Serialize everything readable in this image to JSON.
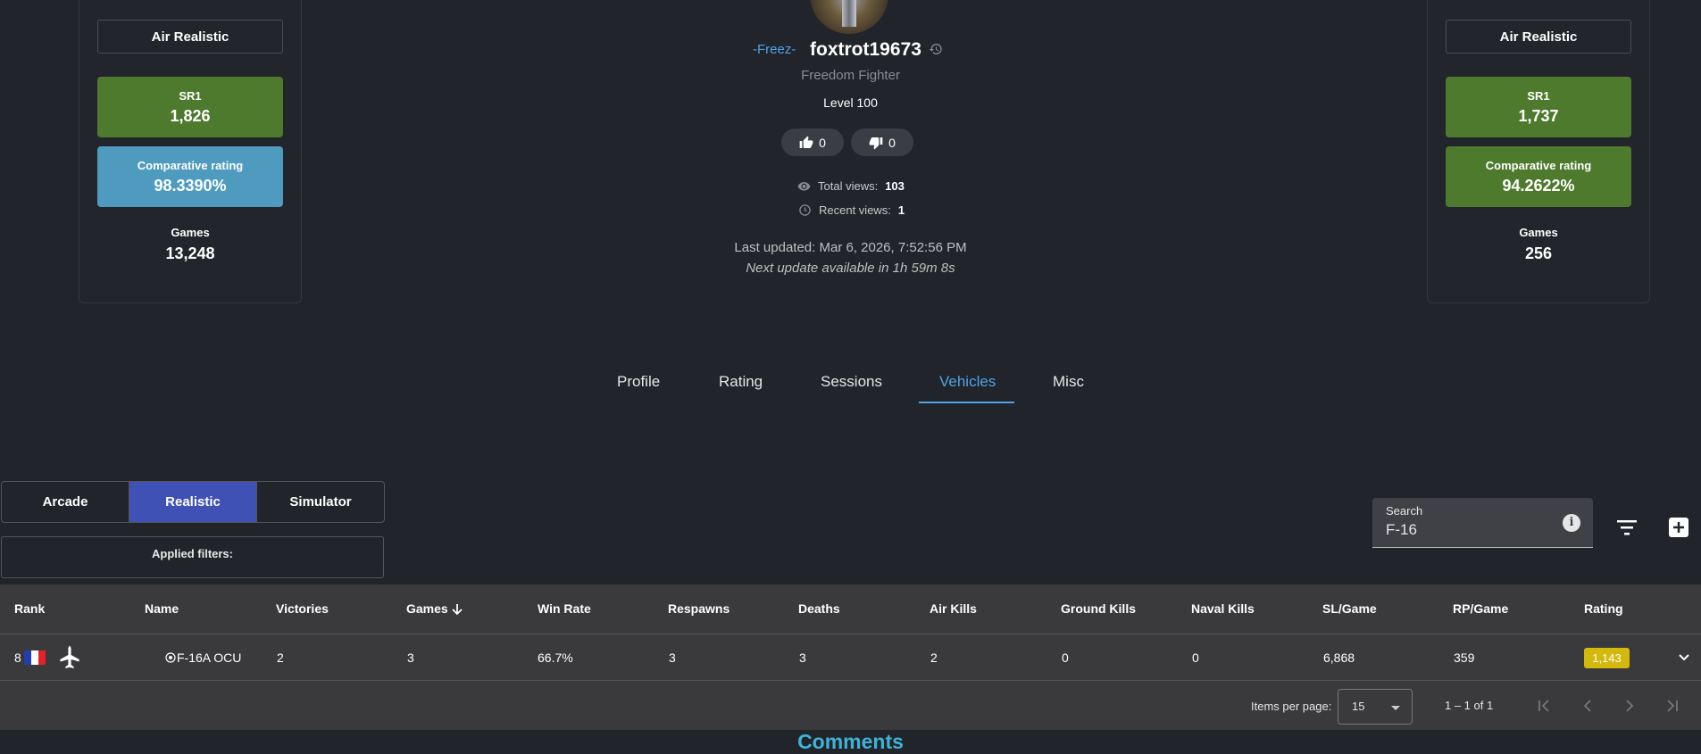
{
  "left_card": {
    "mode": "Air Realistic",
    "sr_label": "SR1",
    "sr_value": "1,826",
    "comp_label": "Comparative rating",
    "comp_value": "98.3390%",
    "games_label": "Games",
    "games_value": "13,248",
    "comp_color": "#4f9bc0"
  },
  "right_card": {
    "mode": "Air Realistic",
    "sr_label": "SR1",
    "sr_value": "1,737",
    "comp_label": "Comparative rating",
    "comp_value": "94.2622%",
    "games_label": "Games",
    "games_value": "256",
    "comp_color": "#4e7a2e"
  },
  "profile": {
    "clan": "-Freez-",
    "nickname": "foxtrot19673",
    "title": "Freedom Fighter",
    "level": "Level 100",
    "likes": "0",
    "dislikes": "0",
    "total_views_label": "Total views:",
    "total_views": "103",
    "recent_views_label": "Recent views:",
    "recent_views": "1",
    "last_updated": "Last updated: Mar 6, 2026, 7:52:56 PM",
    "next_update": "Next update available in 1h 59m 8s"
  },
  "tabs": [
    {
      "label": "Profile"
    },
    {
      "label": "Rating"
    },
    {
      "label": "Sessions"
    },
    {
      "label": "Vehicles",
      "active": true
    },
    {
      "label": "Misc"
    }
  ],
  "game_modes": [
    "Arcade",
    "Realistic",
    "Simulator"
  ],
  "active_mode": "Realistic",
  "applied_filters_label": "Applied filters:",
  "search": {
    "label": "Search",
    "value": "F-16"
  },
  "table": {
    "headers": [
      "Rank",
      "Name",
      "Victories",
      "Games",
      "Win Rate",
      "Respawns",
      "Deaths",
      "Air Kills",
      "Ground Kills",
      "Naval Kills",
      "SL/Game",
      "RP/Game",
      "Rating"
    ],
    "sorted_column": "Games",
    "rows": [
      {
        "rank": "8",
        "nation": "France",
        "name": "F-16A OCU",
        "victories": "2",
        "games": "3",
        "win_rate": "66.7%",
        "respawns": "3",
        "deaths": "3",
        "air_kills": "2",
        "ground_kills": "0",
        "naval_kills": "0",
        "sl_game": "6,868",
        "rp_game": "359",
        "rating": "1,143"
      }
    ]
  },
  "pagination": {
    "items_per_page_label": "Items per page:",
    "items_per_page": "15",
    "range": "1 – 1 of 1"
  },
  "comments_title": "Comments",
  "colors": {
    "accent": "#4fa3e8",
    "sr_green": "#4e7a2e",
    "realistic_active": "#3f51b5",
    "rating_badge": "#d4b80c"
  }
}
